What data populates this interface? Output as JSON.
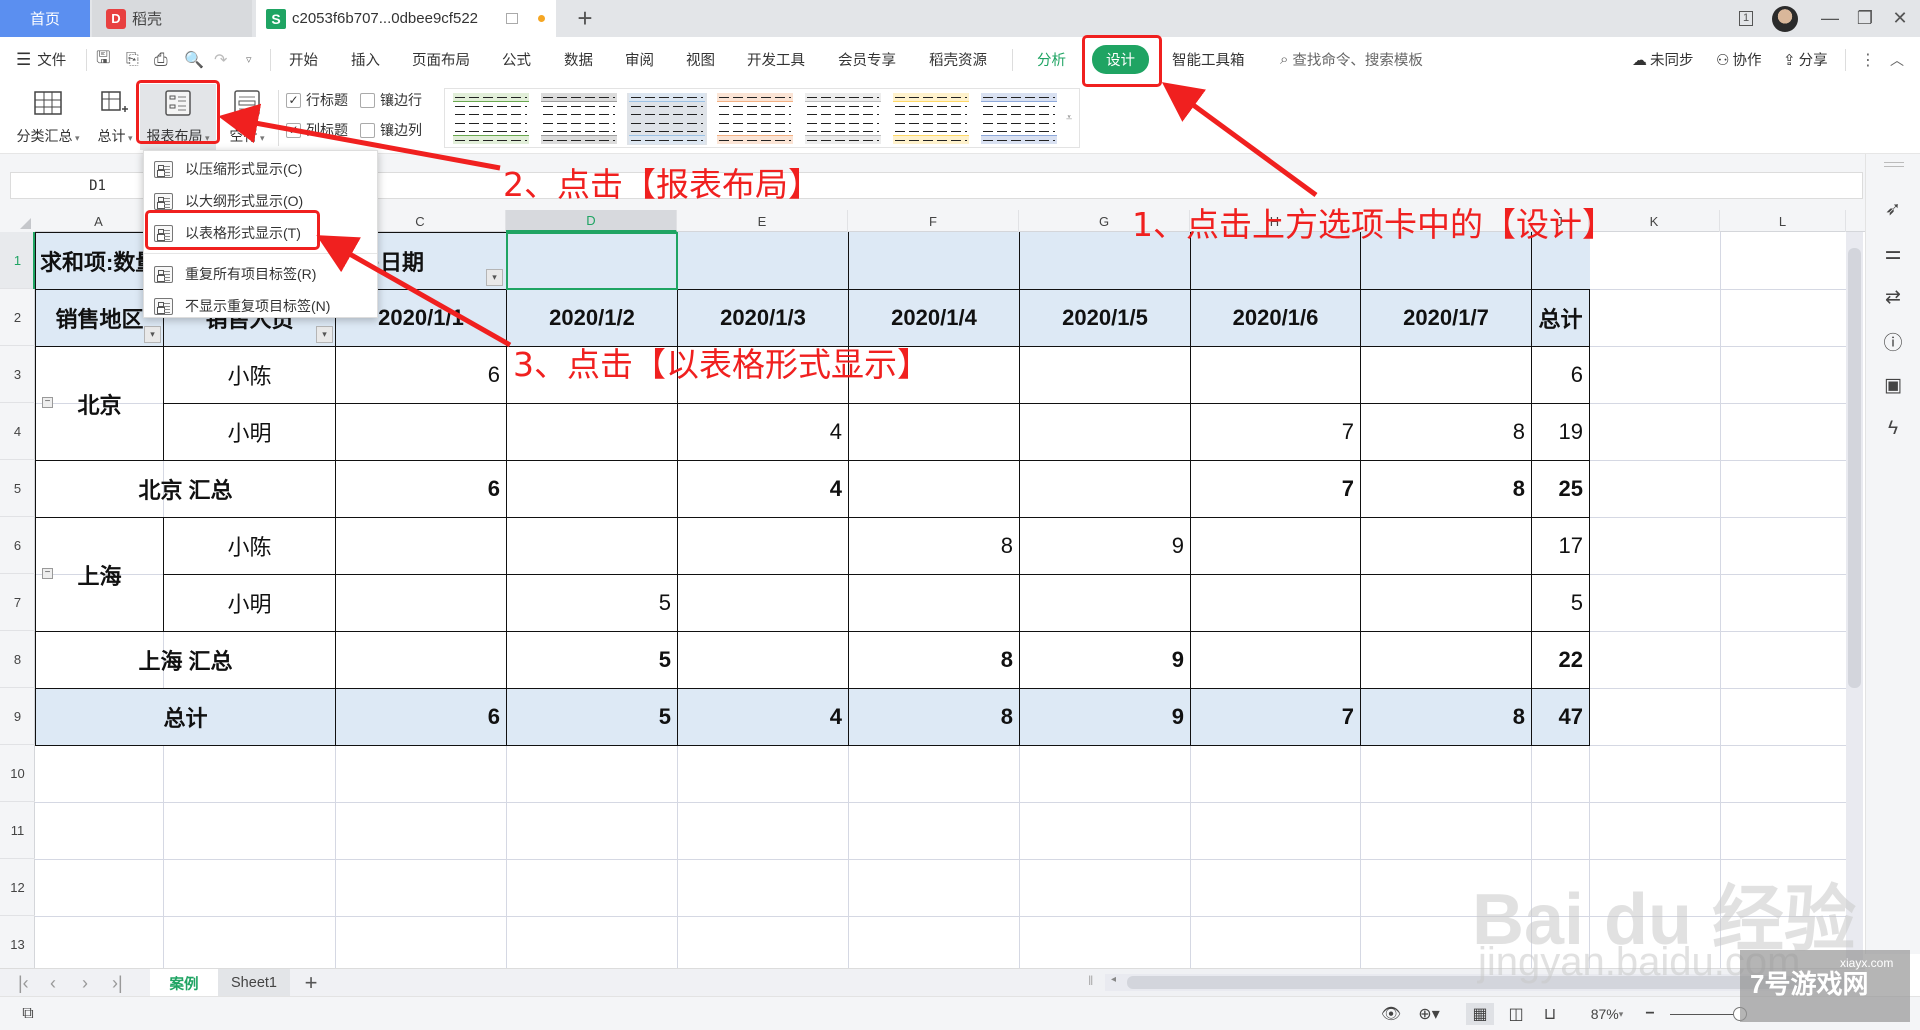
{
  "window": {
    "tabs": [
      {
        "label": "首页"
      },
      {
        "label": "稻壳",
        "logo": "D"
      },
      {
        "label": "c2053f6b707...0dbee9cf522",
        "logo": "S"
      }
    ],
    "add_tab_label": "+",
    "controls": {
      "minimize": "—",
      "restore": "❐",
      "close": "✕",
      "window_count": "1"
    }
  },
  "menubar": {
    "file_label": "文件",
    "items": [
      "开始",
      "插入",
      "页面布局",
      "公式",
      "数据",
      "审阅",
      "视图",
      "开发工具",
      "会员专享",
      "稻壳资源"
    ],
    "context_items": [
      {
        "label": "分析",
        "color": "#1fa463"
      },
      {
        "label": "设计",
        "active": true,
        "color": "#1fa463"
      },
      {
        "label": "智能工具箱"
      }
    ],
    "search_placeholder": "查找命令、搜索模板",
    "right_items": [
      "未同步",
      "协作",
      "分享"
    ]
  },
  "ribbon": {
    "buttons": [
      {
        "label": "分类汇总",
        "icon": "subtotal-icon"
      },
      {
        "label": "总计",
        "icon": "grand-total-icon"
      },
      {
        "label": "报表布局",
        "icon": "report-layout-icon",
        "active": true
      },
      {
        "label": "空行",
        "icon": "blank-row-icon"
      }
    ],
    "checkboxes": [
      {
        "label": "行标题",
        "checked": true
      },
      {
        "label": "镶边行",
        "checked": false
      },
      {
        "label": "列标题",
        "checked": true
      },
      {
        "label": "镶边列",
        "checked": false
      }
    ],
    "styles": [
      {
        "accent": "#6aa84f",
        "fill": "#e2efd9"
      },
      {
        "accent": "#9e9e9e",
        "fill": "#dcdcdc"
      },
      {
        "accent": "#9dc3e6",
        "fill": "#dce6f1"
      },
      {
        "accent": "#f4b183",
        "fill": "#fbe4d5"
      },
      {
        "accent": "#bfbfbf",
        "fill": "#ededed"
      },
      {
        "accent": "#ffd966",
        "fill": "#fff2cc"
      },
      {
        "accent": "#8ea9db",
        "fill": "#d9e1f2"
      }
    ]
  },
  "layout_menu": {
    "items": [
      {
        "label": "以压缩形式显示(C)"
      },
      {
        "label": "以大纲形式显示(O)"
      },
      {
        "label": "以表格形式显示(T)",
        "highlighted": true
      },
      {
        "label": "重复所有项目标签(R)"
      },
      {
        "label": "不显示重复项目标签(N)"
      }
    ]
  },
  "formula_bar": {
    "name_box": "D1",
    "formula": ""
  },
  "sheet": {
    "columns": [
      "A",
      "B",
      "C",
      "D",
      "E",
      "F",
      "G",
      "H",
      "I",
      "J",
      "K",
      "L"
    ],
    "selected_column": "D",
    "rows": [
      "1",
      "2",
      "3",
      "4",
      "5",
      "6",
      "7",
      "8",
      "9",
      "10",
      "11",
      "12",
      "13"
    ],
    "selected_row": "1",
    "pivot": {
      "value_label": "求和项:数量",
      "column_field": "销售日期",
      "row_fields": [
        "销售地区",
        "销售人员"
      ],
      "dates": [
        "2020/1/1",
        "2020/1/2",
        "2020/1/3",
        "2020/1/4",
        "2020/1/5",
        "2020/1/6",
        "2020/1/7"
      ],
      "grand_total_label": "总计",
      "regions": [
        {
          "name": "北京",
          "people": [
            {
              "name": "小陈",
              "values": [
                "6",
                "",
                "",
                "",
                "",
                "",
                ""
              ],
              "total": "6"
            },
            {
              "name": "小明",
              "values": [
                "",
                "",
                "4",
                "",
                "",
                "7",
                "8"
              ],
              "total": "19"
            }
          ],
          "subtotal_label": "北京 汇总",
          "subtotal": [
            "6",
            "",
            "4",
            "",
            "",
            "7",
            "8"
          ],
          "subtotal_total": "25"
        },
        {
          "name": "上海",
          "people": [
            {
              "name": "小陈",
              "values": [
                "",
                "",
                "",
                "8",
                "9",
                "",
                ""
              ],
              "total": "17"
            },
            {
              "name": "小明",
              "values": [
                "",
                "5",
                "",
                "",
                "",
                "",
                ""
              ],
              "total": "5"
            }
          ],
          "subtotal_label": "上海 汇总",
          "subtotal": [
            "",
            "5",
            "",
            "8",
            "9",
            "",
            ""
          ],
          "subtotal_total": "22"
        }
      ],
      "grand_total": [
        "6",
        "5",
        "4",
        "8",
        "9",
        "7",
        "8"
      ],
      "grand_total_total": "47"
    }
  },
  "sheet_tabs": [
    {
      "label": "案例",
      "active": true
    },
    {
      "label": "Sheet1",
      "active": false
    }
  ],
  "statusbar": {
    "zoom": "87%"
  },
  "annotations": [
    {
      "text": "1、点击上方选项卡中的【设计】"
    },
    {
      "text": "2、点击【报表布局】"
    },
    {
      "text": "3、点击【以表格形式显示】"
    }
  ],
  "watermarks": {
    "baidu": "Bai du 经验",
    "baidu_url": "jingyan.baidu.com",
    "site": "7号游戏网",
    "site_url": "xiayx.com"
  }
}
